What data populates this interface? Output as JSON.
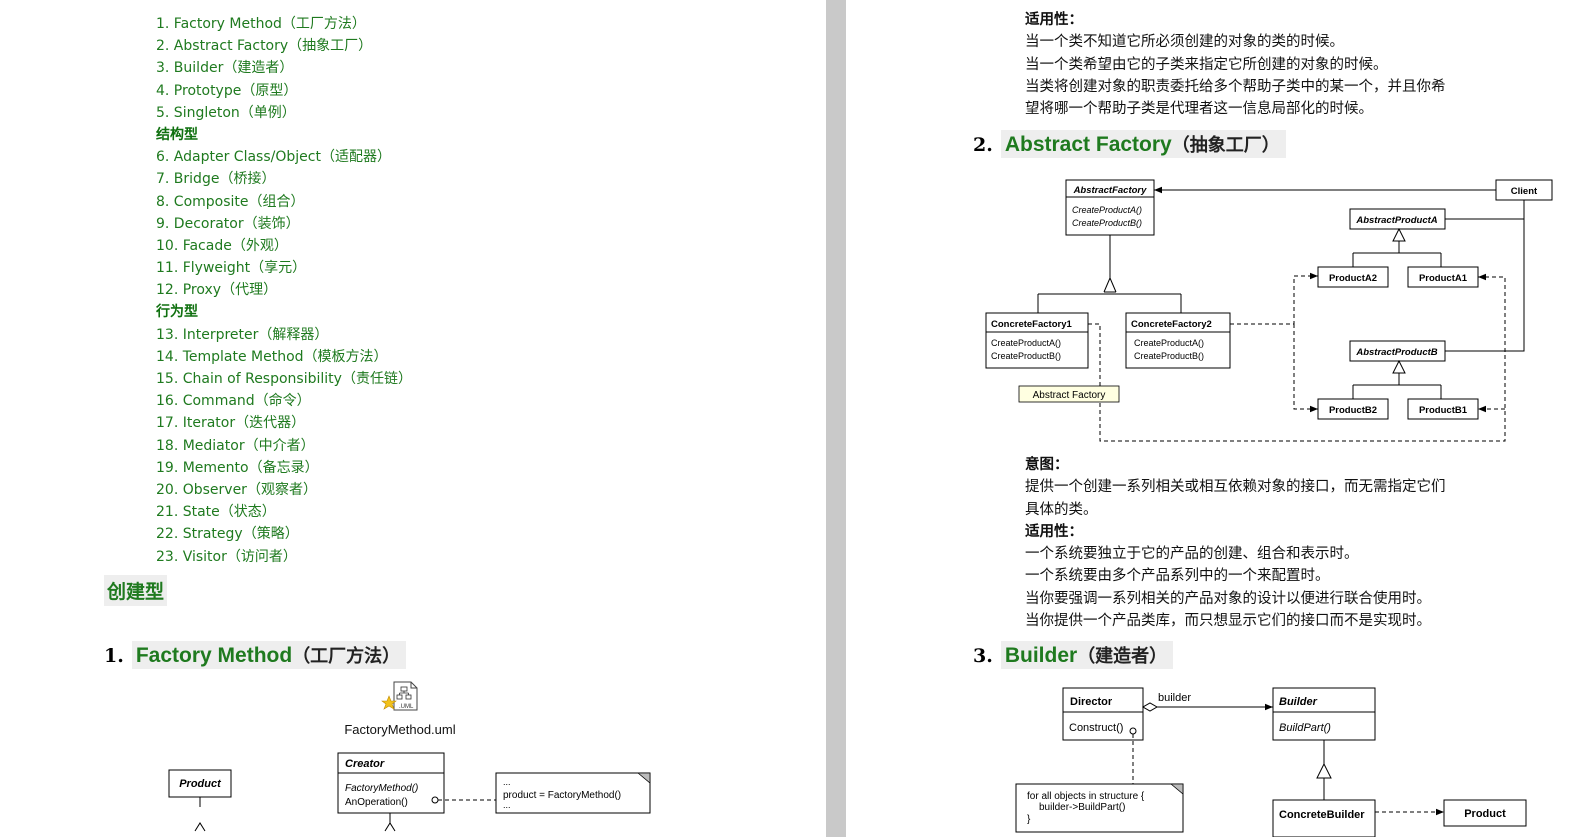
{
  "toc": {
    "items": [
      {
        "label": "1. Factory Method（工厂方法）"
      },
      {
        "label": "2. Abstract Factory（抽象工厂）"
      },
      {
        "label": "3. Builder（建造者）"
      },
      {
        "label": "4. Prototype（原型）"
      },
      {
        "label": "5. Singleton（单例）"
      },
      {
        "label": "结构型"
      },
      {
        "label": "6. Adapter Class/Object（适配器）"
      },
      {
        "label": "7. Bridge（桥接）"
      },
      {
        "label": "8. Composite（组合）"
      },
      {
        "label": "9. Decorator（装饰）"
      },
      {
        "label": "10. Facade（外观）"
      },
      {
        "label": "11. Flyweight（享元）"
      },
      {
        "label": "12. Proxy（代理）"
      },
      {
        "label": "行为型"
      },
      {
        "label": "13. Interpreter（解释器）"
      },
      {
        "label": "14. Template Method（模板方法）"
      },
      {
        "label": "15. Chain of Responsibility（责任链）"
      },
      {
        "label": "16. Command（命令）"
      },
      {
        "label": "17. Iterator（迭代器）"
      },
      {
        "label": "18. Mediator（中介者）"
      },
      {
        "label": "19. Memento（备忘录）"
      },
      {
        "label": "20. Observer（观察者）"
      },
      {
        "label": "21. State（状态）"
      },
      {
        "label": "22. Strategy（策略）"
      },
      {
        "label": "23. Visitor（访问者）"
      }
    ]
  },
  "chapter_heading": "创建型",
  "sections": {
    "factory_method": {
      "num": "1.",
      "en": "Factory Method",
      "cn": "（工厂方法）",
      "file_label": "FactoryMethod.uml"
    },
    "abstract_factory": {
      "num": "2.",
      "en": "Abstract Factory",
      "cn": "（抽象工厂）"
    },
    "builder": {
      "num": "3.",
      "en": "Builder",
      "cn": "（建造者）"
    }
  },
  "factory_method_applicability": {
    "title": "适用性：",
    "lines": [
      "当一个类不知道它所必须创建的对象的类的时候。",
      "当一个类希望由它的子类来指定它所创建的对象的时候。",
      "当类将创建对象的职责委托给多个帮助子类中的某一个，并且你希",
      "望将哪一个帮助子类是代理者这一信息局部化的时候。"
    ]
  },
  "abstract_factory_text": {
    "intent_title": "意图：",
    "intent_lines": [
      "提供一个创建一系列相关或相互依赖对象的接口，而无需指定它们",
      "具体的类。"
    ],
    "applicability_title": "适用性：",
    "applicability_lines": [
      "一个系统要独立于它的产品的创建、组合和表示时。",
      "一个系统要由多个产品系列中的一个来配置时。",
      "当你要强调一系列相关的产品对象的设计以便进行联合使用时。",
      "当你提供一个产品类库，而只想显示它们的接口而不是实现时。"
    ]
  },
  "diagrams": {
    "abstract_factory": {
      "abstract_factory": "AbstractFactory",
      "create_a": "CreateProductA()",
      "create_b": "CreateProductB()",
      "client": "Client",
      "abstract_product_a": "AbstractProductA",
      "product_a2": "ProductA2",
      "product_a1": "ProductA1",
      "concrete_factory_1": "ConcreteFactory1",
      "concrete_factory_2": "ConcreteFactory2",
      "abstract_product_b": "AbstractProductB",
      "product_b2": "ProductB2",
      "product_b1": "ProductB1",
      "tag": "Abstract Factory"
    },
    "builder": {
      "director": "Director",
      "construct": "Construct()",
      "builder_role": "builder",
      "builder": "Builder",
      "build_part": "BuildPart()",
      "note_line1": "for all objects in structure {",
      "note_line2": "builder->BuildPart()",
      "note_line3": "}",
      "concrete_builder": "ConcreteBuilder",
      "product": "Product"
    },
    "factory_method": {
      "product": "Product",
      "creator": "Creator",
      "factory_method": "FactoryMethod()",
      "an_operation": "AnOperation()",
      "note_line1": "...",
      "note_line2": "product = FactoryMethod()",
      "note_line3": "..."
    }
  }
}
